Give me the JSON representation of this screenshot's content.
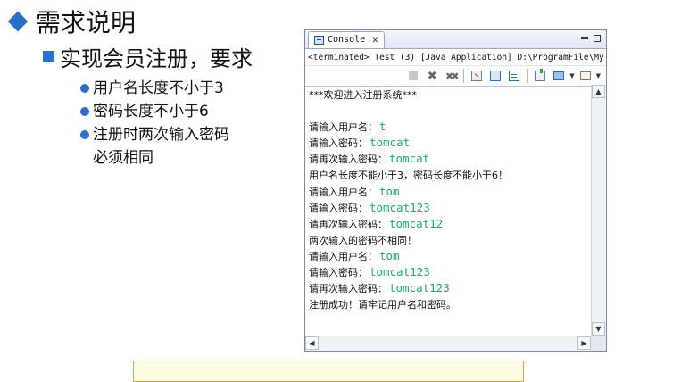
{
  "slide": {
    "title": "需求说明",
    "subheading": "实现会员注册，要求",
    "requirements": [
      "用户名长度不小于3",
      "密码长度不小于6",
      "注册时两次输入密码\n必须相同"
    ]
  },
  "console": {
    "tab_label": "Console",
    "status": "<terminated> Test (3) [Java Application] D:\\ProgramFile\\My",
    "toolbar_icons": [
      "terminate-icon",
      "remove-launch-icon",
      "remove-all-terminated-icon",
      "clear-console-icon",
      "scroll-lock-icon",
      "word-wrap-icon",
      "pin-console-icon",
      "display-selected-console-icon",
      "open-console-icon"
    ],
    "lines": [
      {
        "prompt": "***欢迎进入注册系统***",
        "input": ""
      },
      {
        "prompt": "",
        "input": ""
      },
      {
        "prompt": "请输入用户名：",
        "input": "t"
      },
      {
        "prompt": "请输入密码：",
        "input": "tomcat"
      },
      {
        "prompt": "请再次输入密码：",
        "input": "tomcat"
      },
      {
        "prompt": "用户名长度不能小于3，密码长度不能小于6！",
        "input": ""
      },
      {
        "prompt": "请输入用户名：",
        "input": "tom"
      },
      {
        "prompt": "请输入密码：",
        "input": "tomcat123"
      },
      {
        "prompt": "请再次输入密码：",
        "input": "tomcat12"
      },
      {
        "prompt": "两次输入的密码不相同！",
        "input": ""
      },
      {
        "prompt": "请输入用户名：",
        "input": "tom"
      },
      {
        "prompt": "请输入密码：",
        "input": "tomcat123"
      },
      {
        "prompt": "请再次输入密码：",
        "input": "tomcat123"
      },
      {
        "prompt": "注册成功！请牢记用户名和密码。",
        "input": ""
      }
    ]
  },
  "colors": {
    "bullet": "#2a6fc9",
    "input_text": "#1fa86a"
  }
}
